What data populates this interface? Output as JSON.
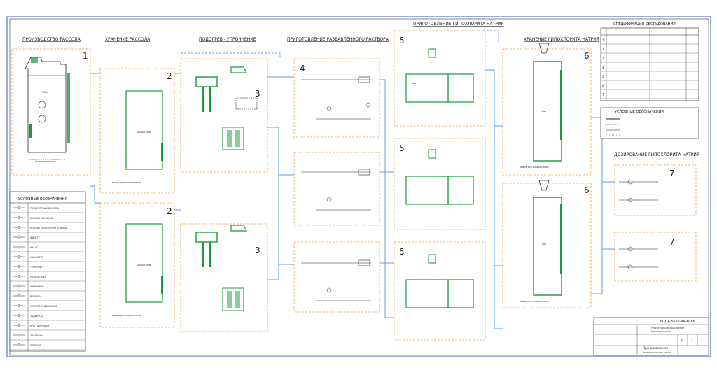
{
  "sections": {
    "s1": {
      "title": "ПРОИЗВОДСТВО РАССОЛА",
      "num": "1"
    },
    "s2": {
      "title": "ХРАНЕНИЕ РАССОЛА",
      "num_top": "2",
      "num_bottom": "2"
    },
    "s3": {
      "title": "ПОДОГРЕВ - УПРОЧНЕНИЕ",
      "num_top": "3",
      "num_bottom": "3"
    },
    "s4": {
      "title": "ПРИГОТОВЛЕНИЕ РАЗБАВЛЕННОГО РАСТВОРА",
      "num": "4"
    },
    "s5": {
      "title": "ПРИГОТОВЛЕНИЕ ГИПОХЛОРИТА НАТРИЯ",
      "num": "5"
    },
    "s6": {
      "title": "ХРАНЕНИЕ ГИПОХЛОРИТА НАТРИЯ",
      "num": "6"
    },
    "s7": {
      "title": "ДОЗИРОВАНИЕ ГИПОХЛОРИТА НАТРИЯ",
      "num": "7"
    }
  },
  "spec": {
    "title": "СПЕЦИФИКАЦИЯ ОБОРУДОВАНИЯ",
    "rows": [
      "1",
      "2",
      "3",
      "4",
      "5",
      "6",
      "7"
    ]
  },
  "legend_right": {
    "title": "УСЛОВНЫЕ ОБОЗНАЧЕНИЯ"
  },
  "legend_left": {
    "title": "УСЛОВНЫЕ ОБОЗНАЧЕНИЯ",
    "rows": [
      "Т-2 ЗАПОРНЫЙ ВЕНТИЛЬ",
      "КЛАПАН ОБРАТНЫЙ",
      "КЛАПАН ПРЕДОХРАНИТЕЛЬНЫЙ",
      "ФИЛЬТР",
      "НАСОС",
      "МАНОМЕТР",
      "ТЕРМОМЕТР",
      "РАСХОДОМЕР",
      "УРОВНЕМЕР",
      "ВЕНТИЛЬ",
      "РЕГУЛЯТОР ДАВЛЕНИЯ",
      "ЗАДВИЖКА",
      "КРАН ШАРОВЫЙ",
      "ЗАГЛУШКА",
      "ПЕРЕХОД"
    ]
  },
  "titleblock": {
    "code": "ЛПДА-5771МА-б-ТХ",
    "project_line1": "Реконструкция сооружений",
    "project_line2": "водоподготовки",
    "stage": "Р",
    "sheet": "1",
    "sheets": "1",
    "drawing_title": "Принципиальная",
    "drawing_sub": "технологическая схема"
  },
  "colors": {
    "section_box": "#e8a24a",
    "pipe": "#5a9fe0",
    "equip": "#1a9a3a",
    "line": "#222222",
    "border": "#3a5ab0"
  }
}
